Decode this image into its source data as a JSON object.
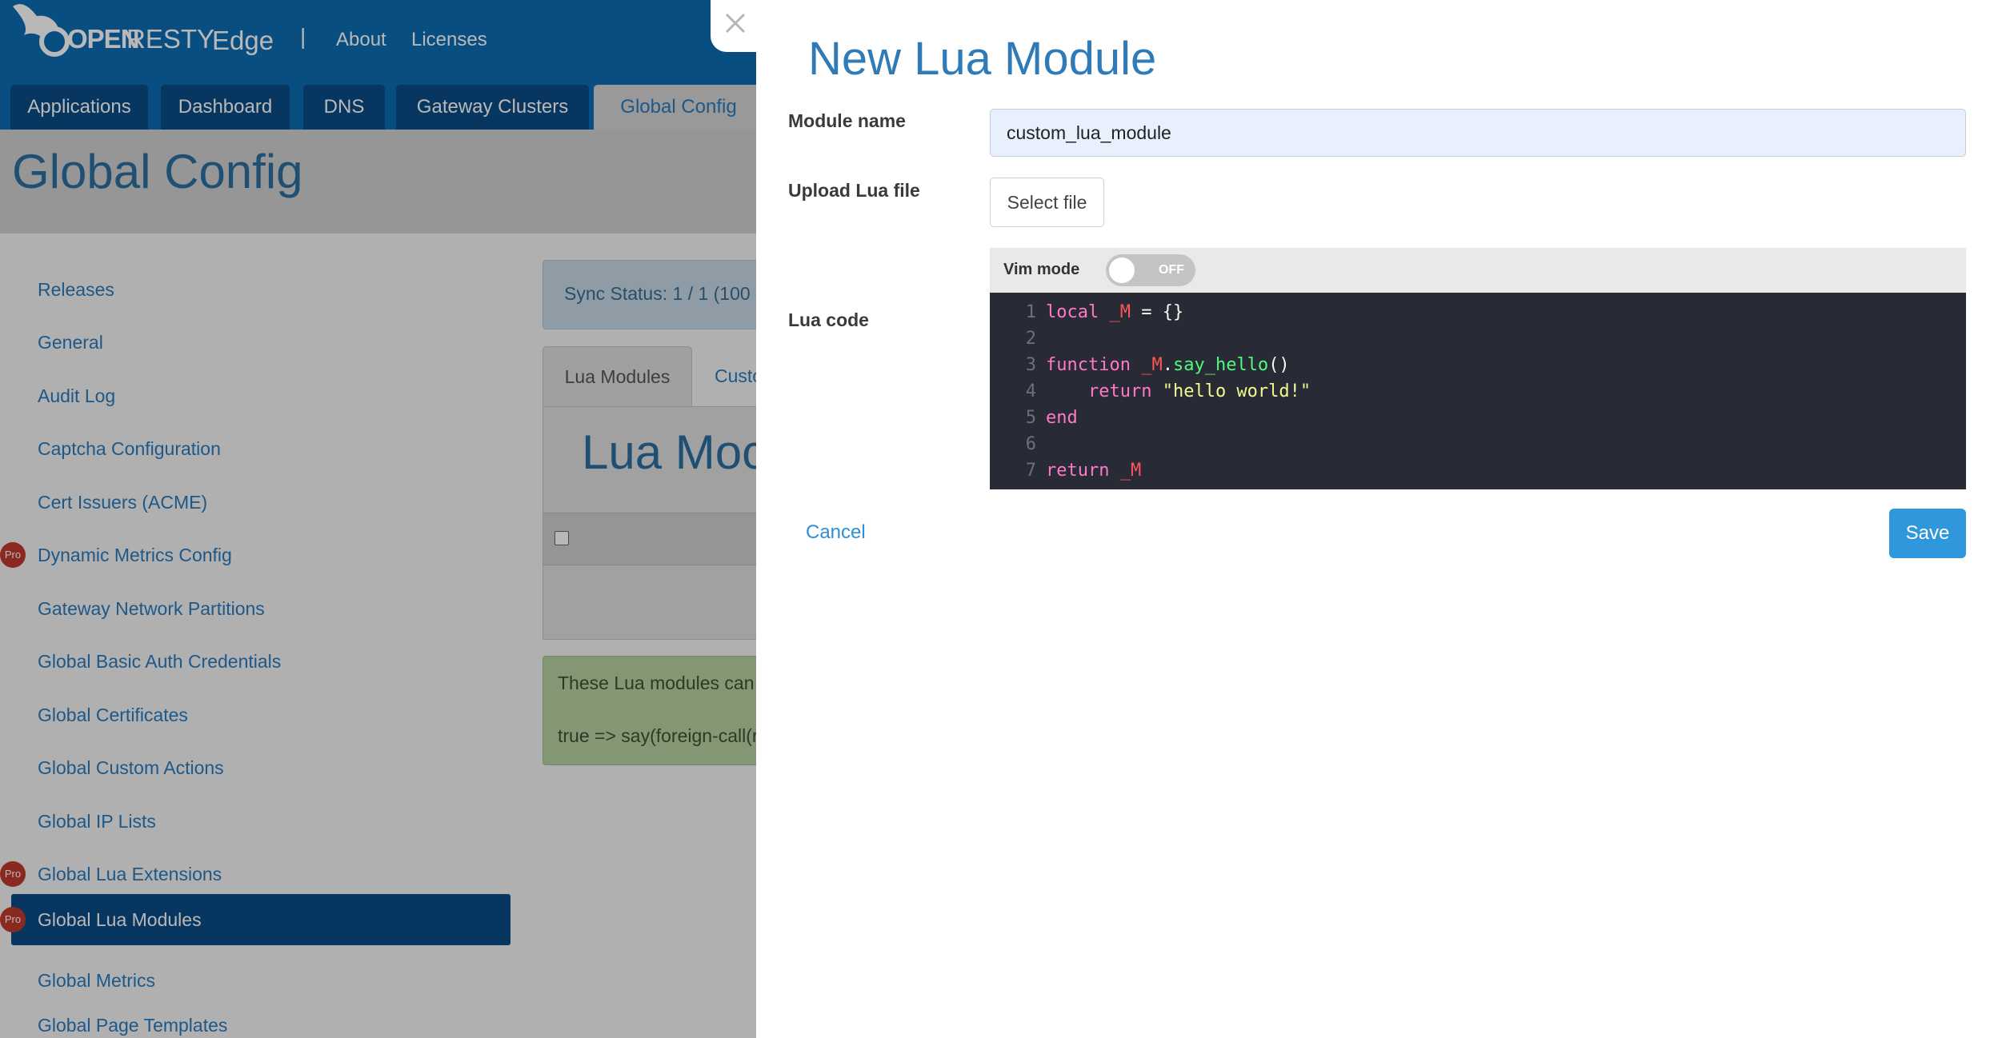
{
  "header": {
    "logo_open": "OPEN",
    "logo_resty": "RESTY",
    "logo_edge": "Edge",
    "separator": "|",
    "links": [
      "About",
      "Licenses"
    ]
  },
  "nav_tabs": [
    {
      "label": "Applications",
      "active": false
    },
    {
      "label": "Dashboard",
      "active": false
    },
    {
      "label": "DNS",
      "active": false
    },
    {
      "label": "Gateway Clusters",
      "active": false
    },
    {
      "label": "Global Config",
      "active": true
    }
  ],
  "page_title": "Global Config",
  "sidebar": {
    "items": [
      {
        "label": "Releases",
        "pro": false
      },
      {
        "label": "General",
        "pro": false
      },
      {
        "label": "Audit Log",
        "pro": false
      },
      {
        "label": "Captcha Configuration",
        "pro": false
      },
      {
        "label": "Cert Issuers (ACME)",
        "pro": false
      },
      {
        "label": "Dynamic Metrics Config",
        "pro": true
      },
      {
        "label": "Gateway Network Partitions",
        "pro": false
      },
      {
        "label": "Global Basic Auth Credentials",
        "pro": false
      },
      {
        "label": "Global Certificates",
        "pro": false
      },
      {
        "label": "Global Custom Actions",
        "pro": false
      },
      {
        "label": "Global IP Lists",
        "pro": false
      },
      {
        "label": "Global Lua Extensions",
        "pro": true
      },
      {
        "label": "Global Lua Modules",
        "pro": true,
        "active": true
      },
      {
        "label": "Global Metrics",
        "pro": false
      },
      {
        "label": "Global Page Templates",
        "pro": false
      }
    ],
    "pro_label": "Pro"
  },
  "content": {
    "sync_status": "Sync Status:   1 / 1 (100",
    "subtabs": [
      "Lua Modules",
      "Custo"
    ],
    "panel_title": "Lua Moc",
    "note_lines": [
      "These Lua modules can",
      "true => say(foreign-call(r"
    ]
  },
  "drawer": {
    "title": "New Lua Module",
    "module_name_label": "Module name",
    "module_name_value": "custom_lua_module",
    "upload_label": "Upload Lua file",
    "select_file_label": "Select file",
    "vim_mode_label": "Vim mode",
    "vim_mode_state": "OFF",
    "lua_code_label": "Lua code",
    "code_lines": [
      "local _M = {}",
      "",
      "function _M.say_hello()",
      "    return \"hello world!\"",
      "end",
      "",
      "return _M"
    ],
    "cancel_label": "Cancel",
    "save_label": "Save"
  },
  "colors": {
    "brand_blue": "#0d6db3",
    "nav_dark": "#0b4d85",
    "save_button": "#2f98dd",
    "pro_badge": "#c0392b",
    "editor_bg": "#282a36"
  }
}
